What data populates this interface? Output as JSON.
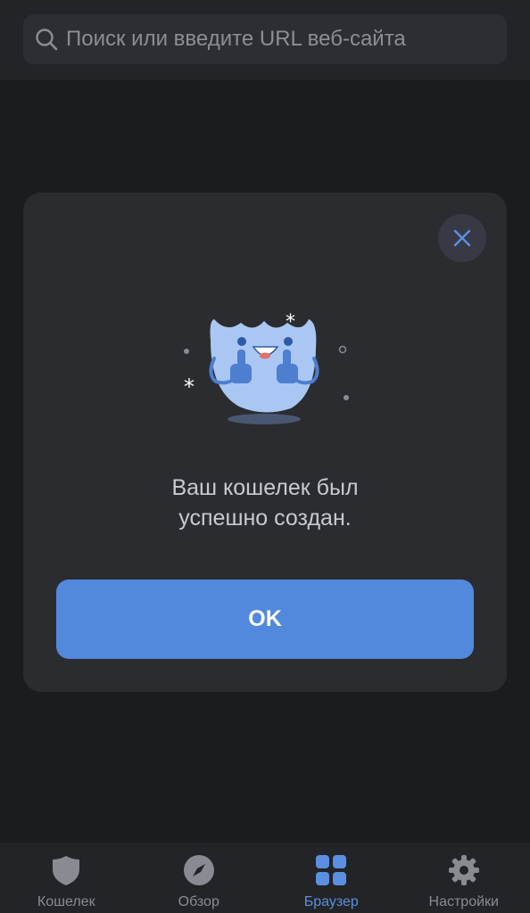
{
  "search": {
    "placeholder": "Поиск или введите URL веб-сайта"
  },
  "modal": {
    "message_line1": "Ваш кошелек был",
    "message_line2": "успешно создан.",
    "ok_label": "OK",
    "close_icon": "close-icon",
    "illustration": "happy-mascot-thumbs-up"
  },
  "tabbar": {
    "items": [
      {
        "label": "Кошелек",
        "icon": "shield-icon",
        "active": false
      },
      {
        "label": "Обзор",
        "icon": "compass-icon",
        "active": false
      },
      {
        "label": "Браузер",
        "icon": "grid-icon",
        "active": true
      },
      {
        "label": "Настройки",
        "icon": "gear-icon",
        "active": false
      }
    ]
  },
  "colors": {
    "background": "#1b1c20",
    "modal": "#2b2c30",
    "accent": "#5389dc",
    "inactive": "#8a8b92"
  }
}
